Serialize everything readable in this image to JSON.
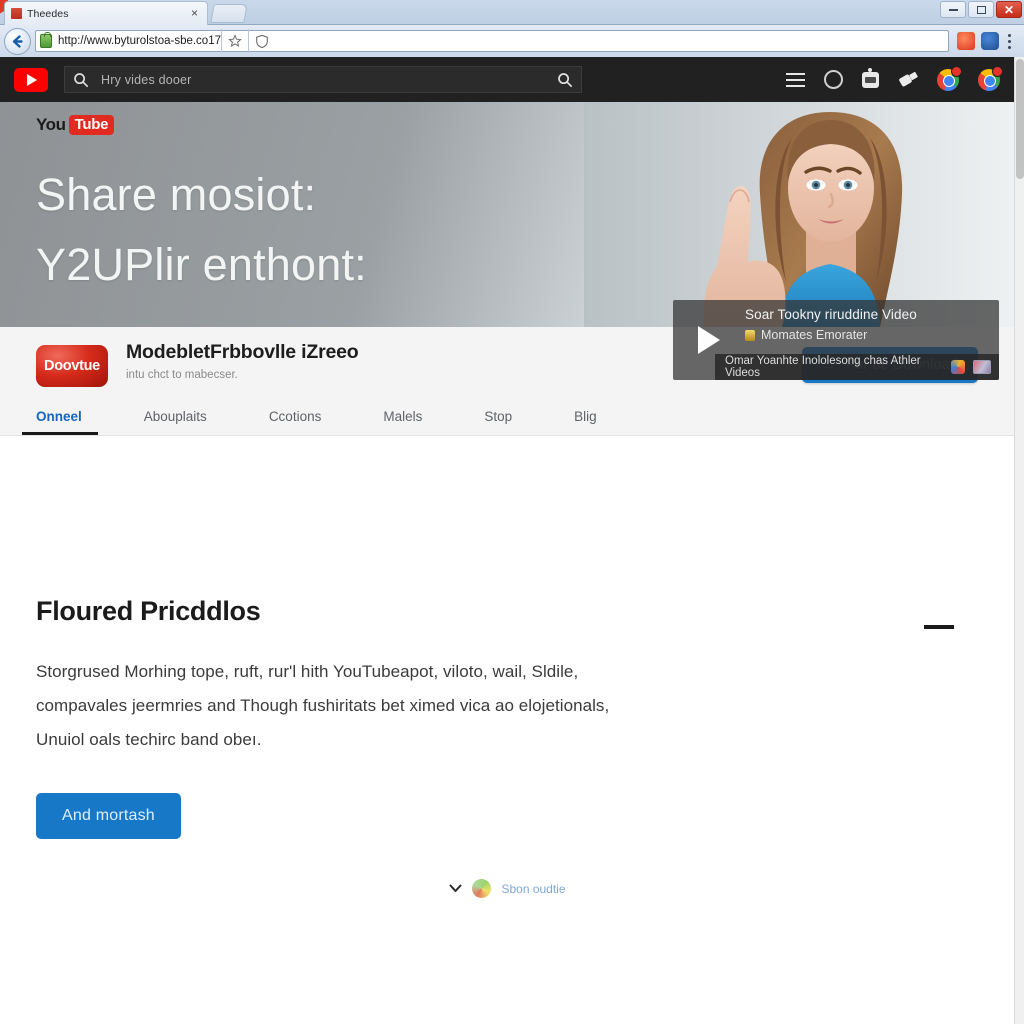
{
  "browser": {
    "tab": {
      "title": "Theedes",
      "close_label": "×",
      "favicon": "page-favicon"
    },
    "newtab_label": "",
    "window_controls": {
      "minimize": "minimize-icon",
      "maximize": "maximize-icon",
      "close": "✕"
    },
    "address": {
      "url": "http://www.byturolstoa-sbe.co17",
      "security_icon": "lock-icon",
      "bookmark_icon": "star-icon",
      "shield_icon": "shield-icon",
      "back_icon": "back-arrow-icon"
    },
    "toolbar_right": {
      "extension_orange": "extension-orange-icon",
      "extension_blue": "extension-blue-icon",
      "menu": "kebab-menu-icon"
    }
  },
  "site_nav": {
    "logo": "youtube-play-logo",
    "search": {
      "placeholder": "Hry vides dooer",
      "left_icon": "search-icon",
      "right_icon": "search-submit-icon"
    },
    "icons": [
      {
        "name": "hamburger-menu-icon"
      },
      {
        "name": "circle-outline-icon"
      },
      {
        "name": "robot-icon"
      },
      {
        "name": "plug-icon"
      },
      {
        "name": "chrome-profile-icon-1",
        "badge": true
      },
      {
        "name": "chrome-profile-icon-2",
        "badge": true
      }
    ]
  },
  "hero": {
    "logo": {
      "you": "You",
      "tube": "Tube"
    },
    "headline_line1": "Share mosiot:",
    "headline_line2": "Y2UPlir enthont:",
    "person_alt": "woman-pointing-up-photo",
    "video_card": {
      "play_icon": "play-triangle-icon",
      "title": "Soar Tookny riruddine Video",
      "subtitle": "Momates Emorater",
      "subtitle_badge": "medal-icon",
      "footer_text": "Omar Yoanhte Inololesong chas Athler Videos",
      "footer_icon_a": "colorful-app-icon",
      "footer_icon_b": "thumbnail-icon"
    }
  },
  "site_header": {
    "logo_text": "Doovtue",
    "title": "ModebletFrbbovlle iZreeo",
    "subtitle": "intu chct to mabecser.",
    "download_button": {
      "label": "Fur be Download",
      "icon": "arrow-right-icon",
      "color": "#1878c8"
    },
    "tabs": [
      {
        "label": "Onneel",
        "active": true
      },
      {
        "label": "Abouplaits",
        "active": false
      },
      {
        "label": "Ccotions",
        "active": false
      },
      {
        "label": "Malels",
        "active": false
      },
      {
        "label": "Stop",
        "active": false
      },
      {
        "label": "Blig",
        "active": false
      }
    ]
  },
  "main": {
    "section_title": "Floured Pricddlos",
    "paragraph_line1": "Storgrused Morhing tope, ruft, rur'l hith YouTubeapot, viloto, wail, Sldile,",
    "paragraph_line2": "compavales jeermries and Though fushiritats bet ximed vica ao elojetionals,",
    "paragraph_line3": "Unuiol oals techirc band obeı.",
    "cta_button": {
      "label": "And mortash",
      "color": "#1878c8"
    },
    "footer": {
      "chevron_icon": "chevron-down-icon",
      "avatar": "user-avatar",
      "text": "Sbon oudtie"
    }
  },
  "colors": {
    "nav_dark": "#212121",
    "brand_red": "#ff0000",
    "accent_blue": "#1878c8",
    "active_tab_blue": "#1565c0",
    "header_bg": "#f4f4f4"
  }
}
